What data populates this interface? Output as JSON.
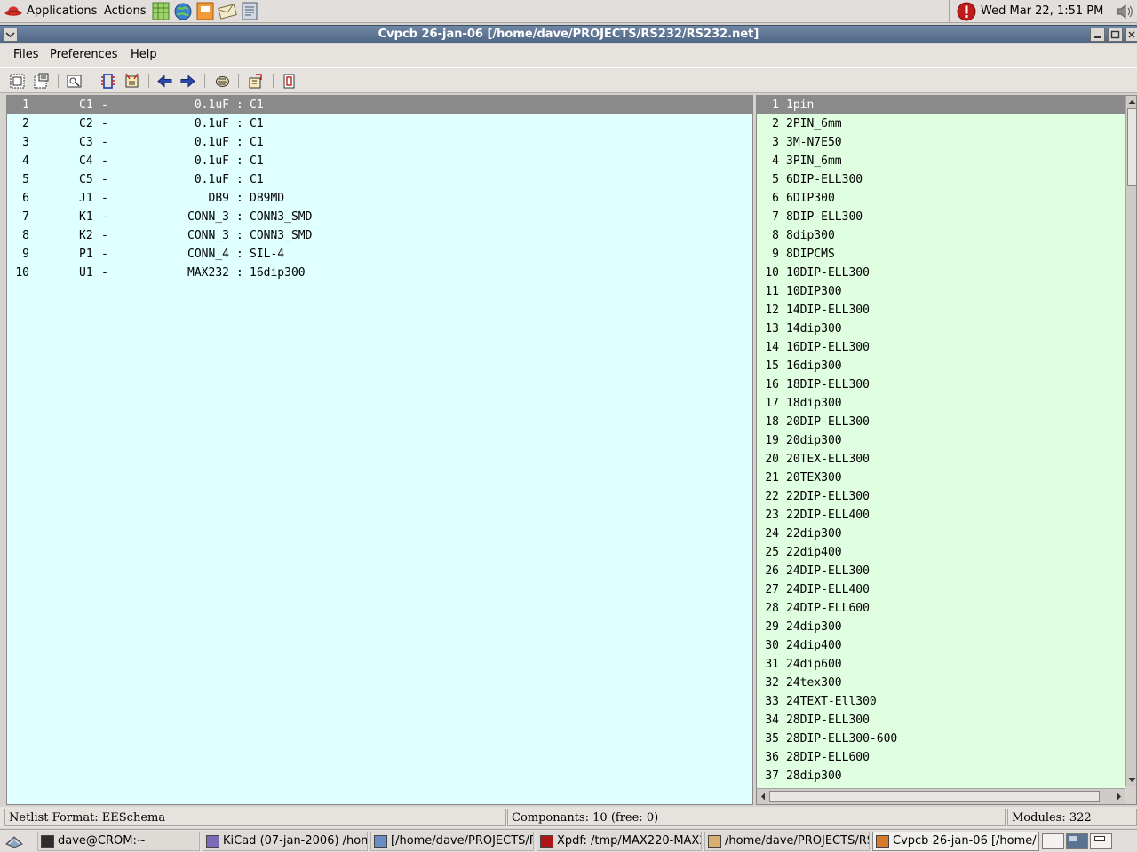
{
  "top_panel": {
    "applications_label": "Applications",
    "actions_label": "Actions",
    "launchers": [
      "spreadsheet-icon",
      "globe-icon",
      "presentation-icon",
      "mail-icon",
      "text-editor-icon"
    ],
    "clock": "Wed Mar 22,  1:51 PM"
  },
  "window": {
    "title": "Cvpcb 26-jan-06 [/home/dave/PROJECTS/RS232/RS232.net]"
  },
  "menubar": {
    "files": {
      "mnemonic": "F",
      "rest": "iles"
    },
    "preferences": {
      "mnemonic": "P",
      "rest": "references"
    },
    "help": {
      "mnemonic": "H",
      "rest": "elp"
    }
  },
  "toolbar": {
    "icons": [
      "save-netlist-icon",
      "open-netlist-icon",
      "configuration-icon",
      "show-module-icon",
      "auto-associate-icon",
      "previous-icon",
      "next-icon",
      "delete-association-icon",
      "load-equ-icon",
      "datasheet-icon"
    ]
  },
  "components": [
    {
      "num": "1",
      "ref": "C1",
      "value": "0.1uF",
      "footprint": "C1"
    },
    {
      "num": "2",
      "ref": "C2",
      "value": "0.1uF",
      "footprint": "C1"
    },
    {
      "num": "3",
      "ref": "C3",
      "value": "0.1uF",
      "footprint": "C1"
    },
    {
      "num": "4",
      "ref": "C4",
      "value": "0.1uF",
      "footprint": "C1"
    },
    {
      "num": "5",
      "ref": "C5",
      "value": "0.1uF",
      "footprint": "C1"
    },
    {
      "num": "6",
      "ref": "J1",
      "value": "DB9",
      "footprint": "DB9MD"
    },
    {
      "num": "7",
      "ref": "K1",
      "value": "CONN_3",
      "footprint": "CONN3_SMD"
    },
    {
      "num": "8",
      "ref": "K2",
      "value": "CONN_3",
      "footprint": "CONN3_SMD"
    },
    {
      "num": "9",
      "ref": "P1",
      "value": "CONN_4",
      "footprint": "SIL-4"
    },
    {
      "num": "10",
      "ref": "U1",
      "value": "MAX232",
      "footprint": "16dip300"
    }
  ],
  "footprints": [
    {
      "num": "1",
      "name": "1pin"
    },
    {
      "num": "2",
      "name": "2PIN_6mm"
    },
    {
      "num": "3",
      "name": "3M-N7E50"
    },
    {
      "num": "4",
      "name": "3PIN_6mm"
    },
    {
      "num": "5",
      "name": "6DIP-ELL300"
    },
    {
      "num": "6",
      "name": "6DIP300"
    },
    {
      "num": "7",
      "name": "8DIP-ELL300"
    },
    {
      "num": "8",
      "name": "8dip300"
    },
    {
      "num": "9",
      "name": "8DIPCMS"
    },
    {
      "num": "10",
      "name": "10DIP-ELL300"
    },
    {
      "num": "11",
      "name": "10DIP300"
    },
    {
      "num": "12",
      "name": "14DIP-ELL300"
    },
    {
      "num": "13",
      "name": "14dip300"
    },
    {
      "num": "14",
      "name": "16DIP-ELL300"
    },
    {
      "num": "15",
      "name": "16dip300"
    },
    {
      "num": "16",
      "name": "18DIP-ELL300"
    },
    {
      "num": "17",
      "name": "18dip300"
    },
    {
      "num": "18",
      "name": "20DIP-ELL300"
    },
    {
      "num": "19",
      "name": "20dip300"
    },
    {
      "num": "20",
      "name": "20TEX-ELL300"
    },
    {
      "num": "21",
      "name": "20TEX300"
    },
    {
      "num": "22",
      "name": "22DIP-ELL300"
    },
    {
      "num": "23",
      "name": "22DIP-ELL400"
    },
    {
      "num": "24",
      "name": "22dip300"
    },
    {
      "num": "25",
      "name": "22dip400"
    },
    {
      "num": "26",
      "name": "24DIP-ELL300"
    },
    {
      "num": "27",
      "name": "24DIP-ELL400"
    },
    {
      "num": "28",
      "name": "24DIP-ELL600"
    },
    {
      "num": "29",
      "name": "24dip300"
    },
    {
      "num": "30",
      "name": "24dip400"
    },
    {
      "num": "31",
      "name": "24dip600"
    },
    {
      "num": "32",
      "name": "24tex300"
    },
    {
      "num": "33",
      "name": "24TEXT-Ell300"
    },
    {
      "num": "34",
      "name": "28DIP-ELL300"
    },
    {
      "num": "35",
      "name": "28DIP-ELL300-600"
    },
    {
      "num": "36",
      "name": "28DIP-ELL600"
    },
    {
      "num": "37",
      "name": "28dip300"
    }
  ],
  "status": {
    "format": "Netlist Format: EESchema",
    "components": "Componants: 10 (free: 0)",
    "modules": "Modules: 322"
  },
  "taskbar": {
    "tasks": [
      {
        "label": "dave@CROM:~",
        "icon": "terminal-icon"
      },
      {
        "label": "KiCad (07-jan-2006) /hom",
        "icon": "kicad-icon"
      },
      {
        "label": "[/home/dave/PROJECTS/R",
        "icon": "eeschema-icon"
      },
      {
        "label": "Xpdf: /tmp/MAX220-MAX2",
        "icon": "xpdf-icon"
      },
      {
        "label": "/home/dave/PROJECTS/RS",
        "icon": "folder-icon"
      },
      {
        "label": "Cvpcb 26-jan-06 [/home/",
        "icon": "cvpcb-icon"
      }
    ]
  },
  "colors": {
    "component_list_bg": "#e0ffff",
    "footprint_list_bg": "#e0ffe0",
    "selection_bg": "#8a8a8a",
    "titlebar": "#5b7392"
  }
}
